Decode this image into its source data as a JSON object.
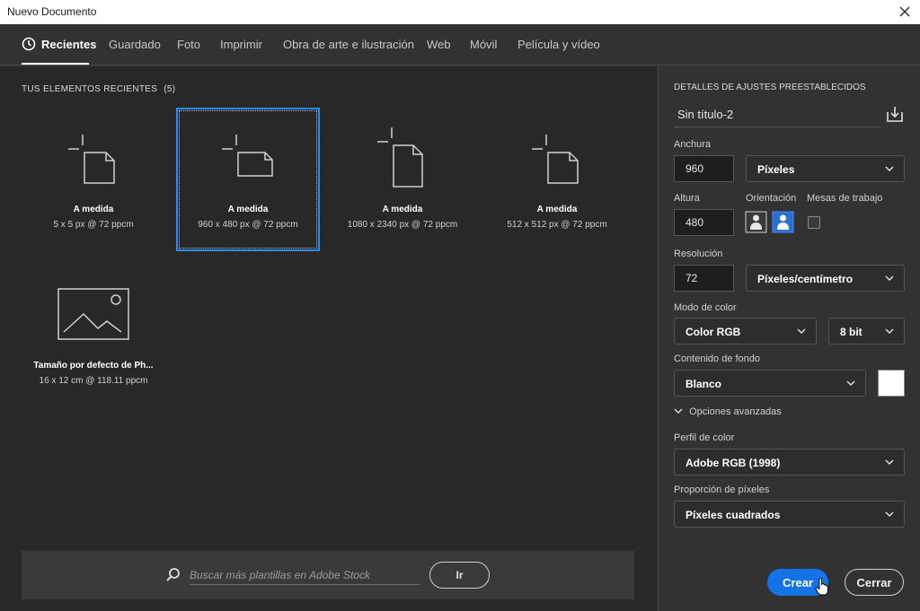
{
  "window": {
    "title": "Nuevo Documento"
  },
  "tabs": [
    {
      "label": "Recientes",
      "active": true
    },
    {
      "label": "Guardado"
    },
    {
      "label": "Foto"
    },
    {
      "label": "Imprimir"
    },
    {
      "label": "Obra de arte e ilustración"
    },
    {
      "label": "Web"
    },
    {
      "label": "Móvil"
    },
    {
      "label": "Película y vídeo"
    }
  ],
  "recent": {
    "heading": "TUS ELEMENTOS RECIENTES",
    "count": "(5)",
    "items": [
      {
        "name": "A medida",
        "meta": "5 x 5 px @ 72 ppcm",
        "icon": "custom-document-icon"
      },
      {
        "name": "A medida",
        "meta": "960 x 480 px @ 72 ppcm",
        "icon": "custom-document-icon",
        "selected": true
      },
      {
        "name": "A medida",
        "meta": "1080 x 2340 px @ 72 ppcm",
        "icon": "custom-document-icon"
      },
      {
        "name": "A medida",
        "meta": "512 x 512 px @ 72 ppcm",
        "icon": "custom-document-icon"
      },
      {
        "name": "Tamaño por defecto de Ph...",
        "meta": "16 x 12 cm @ 118.11 ppcm",
        "icon": "photo-icon"
      }
    ]
  },
  "search": {
    "placeholder": "Buscar más plantillas en Adobe Stock",
    "go_label": "Ir"
  },
  "details": {
    "heading": "DETALLES DE AJUSTES PREESTABLECIDOS",
    "doc_name": "Sin título-2",
    "width_label": "Anchura",
    "width_value": "960",
    "width_unit": "Píxeles",
    "height_label": "Altura",
    "height_value": "480",
    "orientation_label": "Orientación",
    "artboards_label": "Mesas de trabajo",
    "resolution_label": "Resolución",
    "resolution_value": "72",
    "resolution_unit": "Píxeles/centímetro",
    "color_mode_label": "Modo de color",
    "color_mode": "Color RGB",
    "bit_depth": "8 bit",
    "background_label": "Contenido de fondo",
    "background": "Blanco",
    "background_color": "#ffffff",
    "advanced_label": "Opciones avanzadas",
    "profile_label": "Perfil de color",
    "profile": "Adobe RGB (1998)",
    "aspect_label": "Proporción de píxeles",
    "aspect": "Píxeles cuadrados"
  },
  "actions": {
    "create_label": "Crear",
    "close_label": "Cerrar"
  },
  "colors": {
    "accent": "#1473e6",
    "selection": "#2b8cf0"
  }
}
